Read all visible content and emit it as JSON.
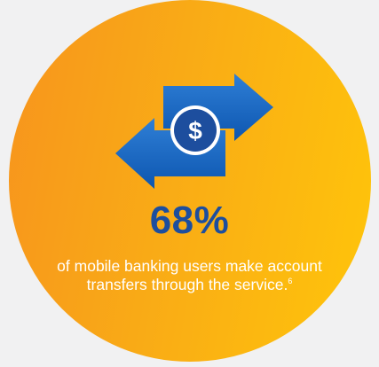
{
  "stat": {
    "value": "68%",
    "caption": "of mobile banking users make account transfers through the service.",
    "footnote": "6"
  },
  "icon": {
    "name": "money-transfer-icon",
    "symbol": "$"
  },
  "colors": {
    "background": "#f1f1f2",
    "circle_start": "#f7941d",
    "circle_end": "#ffc50a",
    "accent_blue": "#1d4e9e",
    "arrow_blue": "#1565c0",
    "text_white": "#ffffff"
  }
}
